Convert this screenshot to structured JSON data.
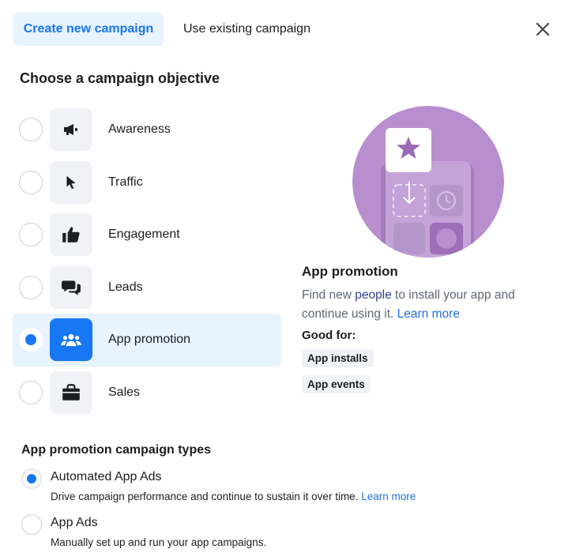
{
  "tabs": [
    {
      "label": "Create new campaign",
      "active": true
    },
    {
      "label": "Use existing campaign",
      "active": false
    }
  ],
  "section_title": "Choose a campaign objective",
  "objectives": [
    {
      "label": "Awareness",
      "icon": "megaphone-icon",
      "selected": false
    },
    {
      "label": "Traffic",
      "icon": "cursor-icon",
      "selected": false
    },
    {
      "label": "Engagement",
      "icon": "thumbs-up-icon",
      "selected": false
    },
    {
      "label": "Leads",
      "icon": "chat-bubbles-icon",
      "selected": false
    },
    {
      "label": "App promotion",
      "icon": "people-group-icon",
      "selected": true
    },
    {
      "label": "Sales",
      "icon": "shopping-bag-icon",
      "selected": false
    }
  ],
  "detail": {
    "title": "App promotion",
    "desc_before": "Find new ",
    "desc_people": "people",
    "desc_after": " to install your app and continue using it. ",
    "learn_more": "Learn more",
    "good_for": "Good for:",
    "chips": [
      "App installs",
      "App events"
    ]
  },
  "types": {
    "title": "App promotion campaign types",
    "options": [
      {
        "name": "Automated App Ads",
        "desc": "Drive campaign performance and continue to sustain it over time.",
        "link": "Learn more",
        "selected": true
      },
      {
        "name": "App Ads",
        "desc": "Manually set up and run your app campaigns.",
        "selected": false
      }
    ]
  },
  "colors": {
    "accent": "#1877f2",
    "selected_bg": "#e7f3ff",
    "link": "#216fdb",
    "illustration_purple": "#b98ecf"
  }
}
